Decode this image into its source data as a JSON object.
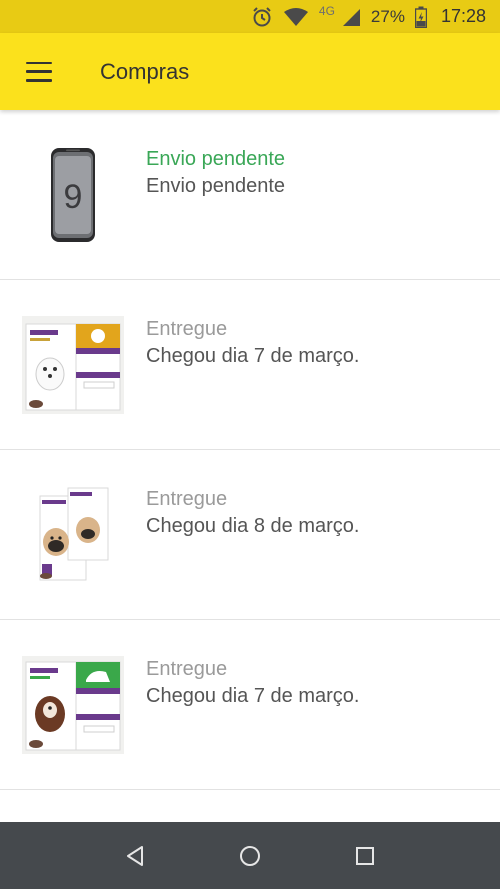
{
  "status_bar": {
    "network": "4G",
    "battery": "27%",
    "time": "17:28",
    "icons": [
      "alarm-icon",
      "wifi-icon",
      "signal-icon",
      "battery-charging-icon"
    ]
  },
  "app_bar": {
    "title": "Compras",
    "menu_icon": "hamburger-menu-icon"
  },
  "colors": {
    "status_bar": "#e8cb14",
    "app_bar": "#fbe11c",
    "pending": "#3aa757",
    "delivered": "#9a9a9a",
    "nav_bar": "#45494d"
  },
  "purchases": [
    {
      "status": "Envio pendente",
      "detail": "Envio pendente",
      "thumb": "smartphone"
    },
    {
      "status": "Entregue",
      "detail": "Chegou dia 7 de março.",
      "thumb": "pet-medicine-small-dog"
    },
    {
      "status": "Entregue",
      "detail": "Chegou dia 8 de março.",
      "thumb": "pet-medicine-pug"
    },
    {
      "status": "Entregue",
      "detail": "Chegou dia 7 de março.",
      "thumb": "pet-medicine-large-dog"
    }
  ],
  "nav": {
    "icons": [
      "back-icon",
      "home-icon",
      "recents-icon"
    ]
  }
}
